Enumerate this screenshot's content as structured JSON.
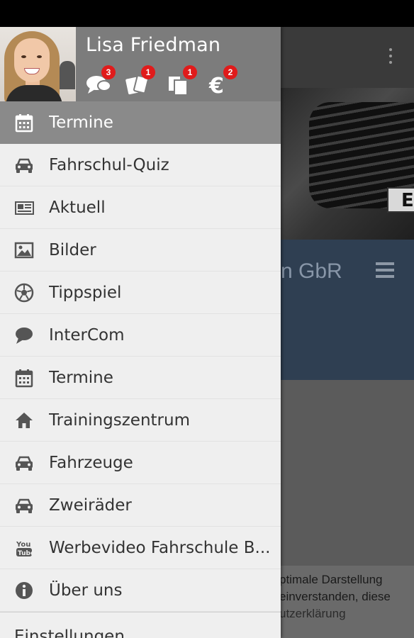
{
  "user": {
    "name": "Lisa Friedman",
    "badges": [
      {
        "icon": "chat-bubbles-icon",
        "count": "3"
      },
      {
        "icon": "cards-icon",
        "count": "1"
      },
      {
        "icon": "documents-icon",
        "count": "1"
      },
      {
        "icon": "euro-icon",
        "count": "2"
      }
    ]
  },
  "menu": {
    "items": [
      {
        "label": "Termine",
        "icon": "calendar-icon",
        "active": true
      },
      {
        "label": "Fahrschul-Quiz",
        "icon": "car-icon"
      },
      {
        "label": "Aktuell",
        "icon": "newspaper-icon"
      },
      {
        "label": "Bilder",
        "icon": "image-icon"
      },
      {
        "label": "Tippspiel",
        "icon": "soccer-ball-icon"
      },
      {
        "label": "InterCom",
        "icon": "chat-bubble-icon"
      },
      {
        "label": "Termine",
        "icon": "calendar-icon"
      },
      {
        "label": "Trainingszentrum",
        "icon": "home-icon"
      },
      {
        "label": "Fahrzeuge",
        "icon": "car-icon"
      },
      {
        "label": "Zweiräder",
        "icon": "car-icon"
      },
      {
        "label": "Werbevideo Fahrschule B...",
        "icon": "youtube-icon"
      },
      {
        "label": "Über uns",
        "icon": "info-icon"
      }
    ],
    "settings_label": "Einstellungen"
  },
  "background": {
    "header_title": "n GbR",
    "plate_text": "E",
    "cookie_lines": [
      "ptimale Darstellung",
      "einverstanden, diese",
      "utzerklärung"
    ]
  },
  "colors": {
    "drawer_header": "#7c7c7c",
    "active_item": "#8a8a8a",
    "badge": "#e01b1b",
    "bg_header": "#2f3f52"
  }
}
